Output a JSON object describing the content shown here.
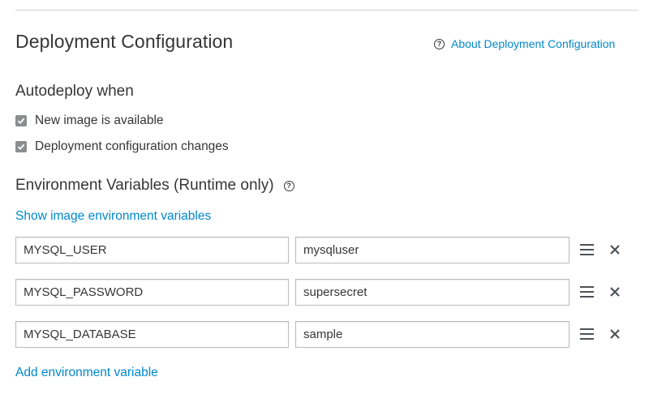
{
  "section": {
    "title": "Deployment Configuration",
    "help_link": "About Deployment Configuration",
    "help_icon": "question-circle-icon"
  },
  "autodeploy": {
    "title": "Autodeploy when",
    "options": [
      {
        "label": "New image is available",
        "checked": true
      },
      {
        "label": "Deployment configuration changes",
        "checked": true
      }
    ]
  },
  "env": {
    "title": "Environment Variables (Runtime only)",
    "show_image_vars_link": "Show image environment variables",
    "add_link": "Add environment variable",
    "rows": [
      {
        "name": "MYSQL_USER",
        "value": "mysqluser"
      },
      {
        "name": "MYSQL_PASSWORD",
        "value": "supersecret"
      },
      {
        "name": "MYSQL_DATABASE",
        "value": "sample"
      }
    ]
  },
  "colors": {
    "link": "#0088ce",
    "text": "#363636",
    "checkbox": "#8b8d8f",
    "border": "#bbbbbb"
  }
}
